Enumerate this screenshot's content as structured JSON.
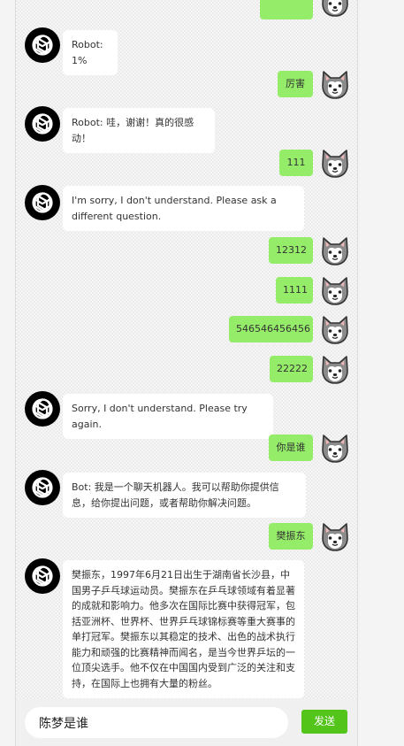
{
  "messages": [
    {
      "role": "user",
      "text": ""
    },
    {
      "role": "bot",
      "text": "Robot: 1%"
    },
    {
      "role": "user",
      "text": "厉害"
    },
    {
      "role": "bot",
      "text": "Robot: 哇，谢谢！真的很感动！"
    },
    {
      "role": "user",
      "text": "111"
    },
    {
      "role": "bot",
      "text": "I'm sorry, I don't understand. Please ask a different question."
    },
    {
      "role": "user",
      "text": "12312"
    },
    {
      "role": "user",
      "text": "1111"
    },
    {
      "role": "user",
      "text": "546546456456"
    },
    {
      "role": "user",
      "text": "22222"
    },
    {
      "role": "bot",
      "text": "Sorry, I don't understand. Please try again."
    },
    {
      "role": "user",
      "text": "你是谁"
    },
    {
      "role": "bot",
      "text": "Bot: 我是一个聊天机器人。我可以帮助你提供信息，给你提出问题，或者帮助你解决问题。"
    },
    {
      "role": "user",
      "text": "樊振东"
    },
    {
      "role": "bot",
      "text": "樊振东，1997年6月21日出生于湖南省长沙县，中国男子乒乓球运动员。樊振东在乒乓球领域有着显著的成就和影响力。他多次在国际比赛中获得冠军，包括亚洲杯、世界杯、世界乒乓球锦标赛等重大赛事的单打冠军。樊振东以其稳定的技术、出色的战术执行能力和顽强的比赛精神而闻名，是当今世界乒坛的一位顶尖选手。他不仅在中国国内受到广泛的关注和支持，在国际上也拥有大量的粉丝。"
    }
  ],
  "input": {
    "value": "陈梦是谁"
  },
  "send": {
    "label": "发送"
  },
  "colors": {
    "user_bubble": "#95ec69",
    "send_button": "#52c41a",
    "bot_bubble": "#ffffff"
  },
  "icons": {
    "bot_avatar": "openai-logo-icon",
    "user_avatar": "shiba-dog-icon"
  }
}
